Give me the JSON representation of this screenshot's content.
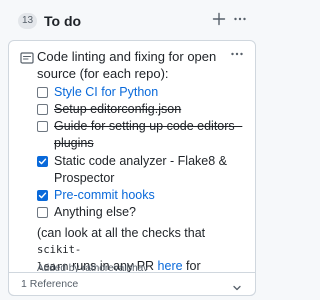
{
  "column": {
    "count": "13",
    "title": "To do"
  },
  "card": {
    "intro": "Code linting and fixing for open source (for each repo):",
    "tasks": [
      {
        "label": "Style CI for Python",
        "checked": false,
        "style": "link"
      },
      {
        "label": "Setup editorconfig.json",
        "checked": false,
        "style": "strike"
      },
      {
        "label": "Guide for setting up code editors -",
        "checked": false,
        "style": "strike"
      },
      {
        "label": "plugins",
        "checked": false,
        "style": "strike"
      },
      {
        "label": "Static code analyzer - Flake8 &",
        "checked": true,
        "style": "plain"
      },
      {
        "label": "Prospector",
        "checked": true,
        "style": "plain"
      },
      {
        "label": "Pre-commit hooks",
        "checked": true,
        "style": "link"
      },
      {
        "label": "Anything else?",
        "checked": false,
        "style": "plain"
      }
    ],
    "note": {
      "prefix": "(can look at all the checks that ",
      "code1": "scikit-",
      "code2": "learn",
      "middle": " runs in any PR ",
      "link": "here",
      "suffix": " for reference)"
    },
    "added_by": "Added by rathorevaibhav"
  },
  "references": {
    "label": "1 Reference"
  },
  "colors": {
    "link": "#0969da",
    "checkbox_checked": "#0969da",
    "muted": "#57606a"
  },
  "icons": {
    "add": "plus-icon",
    "more": "kebab-horizontal-icon",
    "note": "note-icon",
    "chevron": "chevron-down-icon"
  }
}
